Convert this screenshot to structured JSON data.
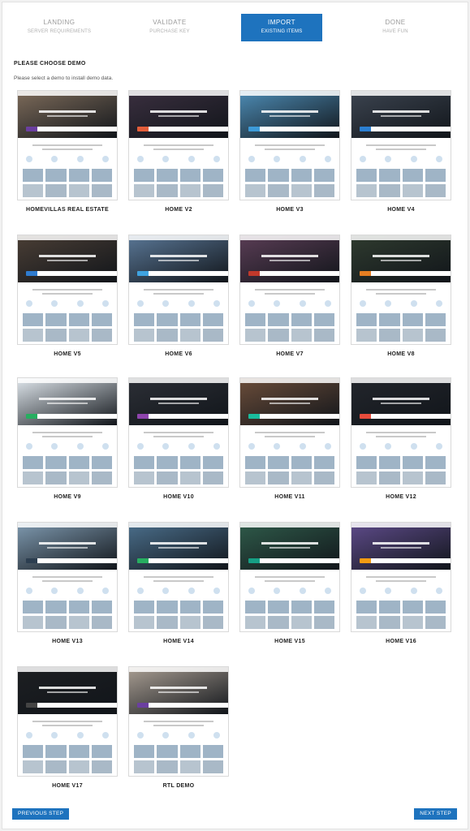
{
  "steps": [
    {
      "title": "LANDING",
      "sub": "SERVER REQUIREMENTS",
      "active": false
    },
    {
      "title": "VALIDATE",
      "sub": "PURCHASE KEY",
      "active": false
    },
    {
      "title": "IMPORT",
      "sub": "EXISTING ITEMS",
      "active": true
    },
    {
      "title": "DONE",
      "sub": "HAVE FUN",
      "active": false
    }
  ],
  "heading": "PLEASE CHOOSE DEMO",
  "subtitle": "Please select a demo to install demo data.",
  "demos": [
    {
      "label": "HOMEVILLAS REAL ESTATE",
      "hero": "#7d6b5a",
      "accent": "#6b3fa0"
    },
    {
      "label": "HOME V2",
      "hero": "#3a2f3f",
      "accent": "#e35d3a"
    },
    {
      "label": "HOME V3",
      "hero": "#4d8cb5",
      "accent": "#3d9bd8"
    },
    {
      "label": "HOME V4",
      "hero": "#3c4450",
      "accent": "#2b7fd1"
    },
    {
      "label": "HOME V5",
      "hero": "#4a3e35",
      "accent": "#2e7bcf"
    },
    {
      "label": "HOME V6",
      "hero": "#5a7796",
      "accent": "#3fa3e0"
    },
    {
      "label": "HOME V7",
      "hero": "#5a3d55",
      "accent": "#c0392b"
    },
    {
      "label": "HOME V8",
      "hero": "#2f3b2f",
      "accent": "#e67e22"
    },
    {
      "label": "HOME V9",
      "hero": "#dfe6ec",
      "accent": "#27ae60"
    },
    {
      "label": "HOME V10",
      "hero": "#2c2f36",
      "accent": "#8e44ad"
    },
    {
      "label": "HOME V11",
      "hero": "#6b4d3a",
      "accent": "#1abc9c"
    },
    {
      "label": "HOME V12",
      "hero": "#23262c",
      "accent": "#e74c3c"
    },
    {
      "label": "HOME V13",
      "hero": "#7f9ab0",
      "accent": "#2c3e50"
    },
    {
      "label": "HOME V14",
      "hero": "#4b6f8c",
      "accent": "#27ae60"
    },
    {
      "label": "HOME V15",
      "hero": "#2f5b4a",
      "accent": "#16a085"
    },
    {
      "label": "HOME V16",
      "hero": "#5e4b8a",
      "accent": "#f39c12"
    },
    {
      "label": "HOME V17",
      "hero": "#1d1f22",
      "accent": "#444444"
    },
    {
      "label": "RTL DEMO",
      "hero": "#a99e93",
      "accent": "#6b3fa0"
    }
  ],
  "buttons": {
    "previous": "PREVIOUS STEP",
    "next": "NEXT STEP"
  }
}
